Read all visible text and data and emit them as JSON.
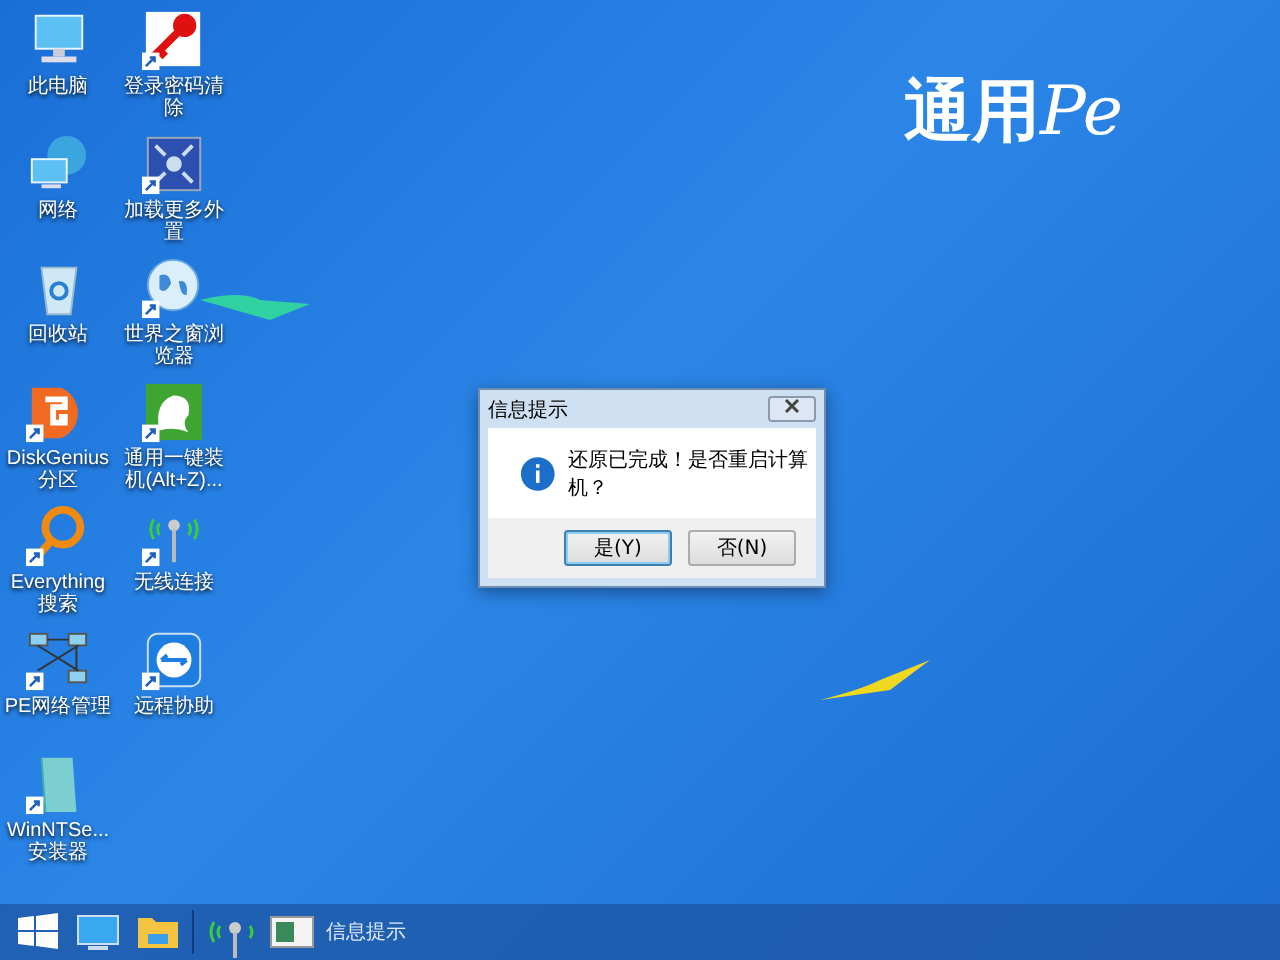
{
  "desktop": {
    "columns": [
      [
        {
          "label": "此电脑",
          "kind": "computer",
          "shortcut": false
        },
        {
          "label": "网络",
          "kind": "network",
          "shortcut": false
        },
        {
          "label": "回收站",
          "kind": "recycle",
          "shortcut": false
        },
        {
          "label": "DiskGenius分区",
          "kind": "disk",
          "shortcut": true
        },
        {
          "label": "Everything搜索",
          "kind": "magnifier",
          "shortcut": true
        },
        {
          "label": "PE网络管理",
          "kind": "lan",
          "shortcut": true
        },
        {
          "label": "WinNTSe...安装器",
          "kind": "installer",
          "shortcut": true
        }
      ],
      [
        {
          "label": "登录密码清除",
          "kind": "key",
          "shortcut": true
        },
        {
          "label": "加载更多外置",
          "kind": "expand",
          "shortcut": true
        },
        {
          "label": "世界之窗浏览器",
          "kind": "globe",
          "shortcut": true
        },
        {
          "label": "通用一键装机(Alt+Z)...",
          "kind": "ghost",
          "shortcut": true
        },
        {
          "label": "无线连接",
          "kind": "antenna",
          "shortcut": true
        },
        {
          "label": "远程协助",
          "kind": "remote",
          "shortcut": true
        }
      ]
    ]
  },
  "logo": {
    "text": "通用",
    "suffix": "Pe"
  },
  "dialog": {
    "title": "信息提示",
    "message": "还原已完成！是否重启计算机？",
    "buttons": [
      {
        "label": "是(Y)",
        "selected": true
      },
      {
        "label": "否(N)",
        "selected": false
      }
    ]
  },
  "taskbar": {
    "items": [
      {
        "kind": "start"
      },
      {
        "kind": "desktop"
      },
      {
        "kind": "folder"
      },
      {
        "kind": "separator"
      },
      {
        "kind": "antenna"
      },
      {
        "kind": "task",
        "label": "信息提示"
      }
    ]
  }
}
